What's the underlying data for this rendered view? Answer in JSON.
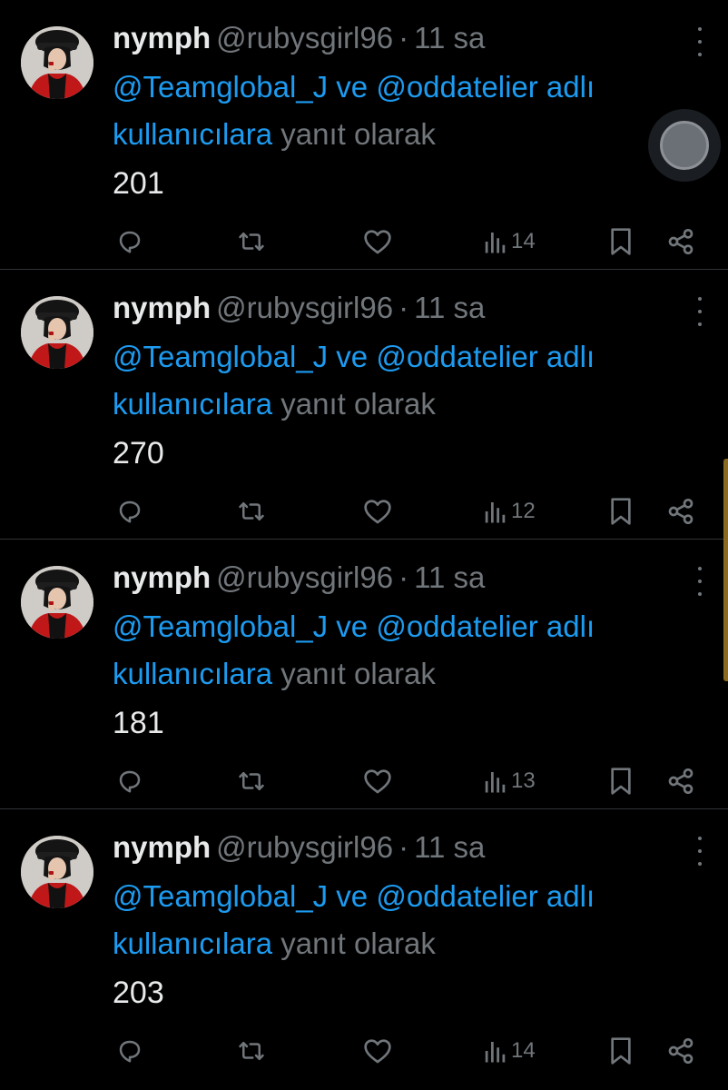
{
  "tweets": [
    {
      "name": "nymph",
      "handle": "@rubysgirl96",
      "dot": "·",
      "time": "11 sa",
      "mention1": "@Teamglobal_J",
      "conj": "ve",
      "mention2": "@oddatelier adlı kullanıcılara",
      "reply_suffix": "yanıt olarak",
      "text": "201",
      "views": "14"
    },
    {
      "name": "nymph",
      "handle": "@rubysgirl96",
      "dot": "·",
      "time": "11 sa",
      "mention1": "@Teamglobal_J",
      "conj": "ve",
      "mention2": "@oddatelier adlı kullanıcılara",
      "reply_suffix": "yanıt olarak",
      "text": "270",
      "views": "12"
    },
    {
      "name": "nymph",
      "handle": "@rubysgirl96",
      "dot": "·",
      "time": "11 sa",
      "mention1": "@Teamglobal_J",
      "conj": "ve",
      "mention2": "@oddatelier adlı kullanıcılara",
      "reply_suffix": "yanıt olarak",
      "text": "181",
      "views": "13"
    },
    {
      "name": "nymph",
      "handle": "@rubysgirl96",
      "dot": "·",
      "time": "11 sa",
      "mention1": "@Teamglobal_J",
      "conj": "ve",
      "mention2": "@oddatelier adlı kullanıcılara",
      "reply_suffix": "yanıt olarak",
      "text": "203",
      "views": "14"
    }
  ],
  "icons": {
    "reply": "reply-icon",
    "retweet": "retweet-icon",
    "like": "heart-icon",
    "views": "views-icon",
    "bookmark": "bookmark-icon",
    "share": "share-icon",
    "more": "more-icon"
  },
  "colors": {
    "background": "#000000",
    "text_primary": "#e7e9ea",
    "text_secondary": "#71767b",
    "link": "#1d9bf0",
    "divider": "#2f3336"
  }
}
